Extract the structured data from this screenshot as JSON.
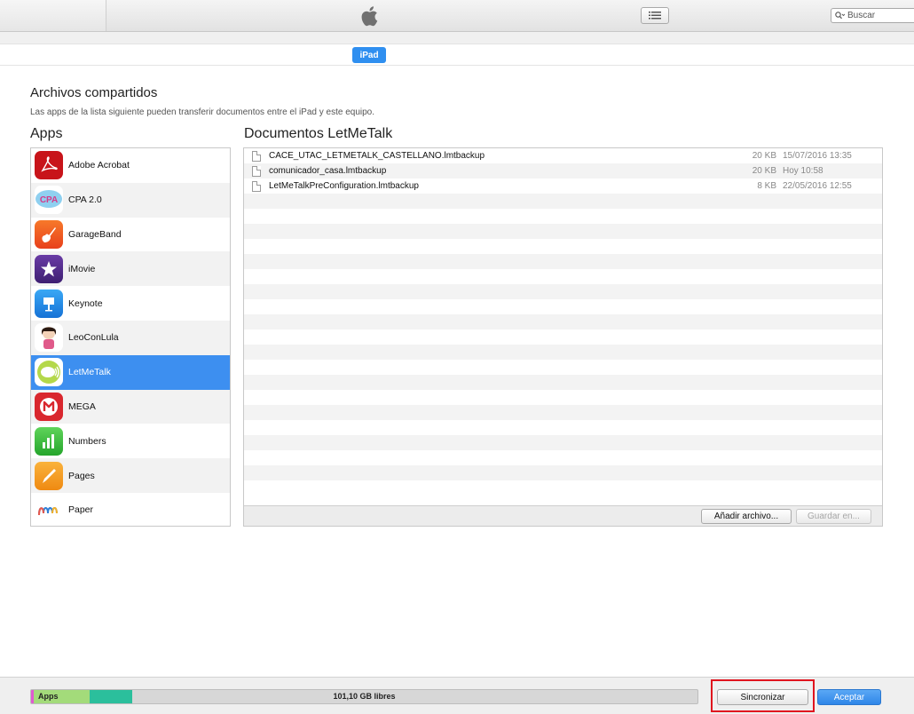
{
  "toolbar": {
    "search_placeholder": "Buscar"
  },
  "device": {
    "label": "iPad"
  },
  "section": {
    "title": "Archivos compartidos",
    "subtitle": "Las apps de la lista siguiente pueden transferir documentos entre el iPad y este equipo."
  },
  "apps": {
    "title": "Apps",
    "items": [
      {
        "label": "Adobe Acrobat",
        "icon": "adobe-acrobat-icon",
        "color": "#c8141a"
      },
      {
        "label": "CPA 2.0",
        "icon": "cpa-icon",
        "color": "#7ec8ef"
      },
      {
        "label": "GarageBand",
        "icon": "garageband-icon",
        "color": "#f35a22"
      },
      {
        "label": "iMovie",
        "icon": "imovie-icon",
        "color": "#5a2d8c"
      },
      {
        "label": "Keynote",
        "icon": "keynote-icon",
        "color": "#1f8fe6"
      },
      {
        "label": "LeoConLula",
        "icon": "leoconlula-icon",
        "color": "#e05a8a"
      },
      {
        "label": "LetMeTalk",
        "icon": "letmetalk-icon",
        "color": "#9ccc3c"
      },
      {
        "label": "MEGA",
        "icon": "mega-icon",
        "color": "#d9272e"
      },
      {
        "label": "Numbers",
        "icon": "numbers-icon",
        "color": "#3cbf3c"
      },
      {
        "label": "Pages",
        "icon": "pages-icon",
        "color": "#f39a1c"
      },
      {
        "label": "Paper",
        "icon": "paper-icon",
        "color": "#e8574a"
      }
    ],
    "selected": "LetMeTalk"
  },
  "documents": {
    "title": "Documentos LetMeTalk",
    "files": [
      {
        "name": "CACE_UTAC_LETMETALK_CASTELLANO.lmtbackup",
        "size": "20 KB",
        "date": "15/07/2016 13:35"
      },
      {
        "name": "comunicador_casa.lmtbackup",
        "size": "20 KB",
        "date": "Hoy 10:58"
      },
      {
        "name": "LetMeTalkPreConfiguration.lmtbackup",
        "size": "8 KB",
        "date": "22/05/2016 12:55"
      }
    ],
    "add_button": "Añadir archivo...",
    "save_button": "Guardar en..."
  },
  "storage": {
    "apps_label": "Apps",
    "free_label": "101,10 GB libres",
    "colors": {
      "other": "#e05ad0",
      "apps": "#a3db7a",
      "media": "#2bbf9c",
      "free": "#d7d7d7"
    }
  },
  "footer": {
    "sync_button": "Sincronizar",
    "accept_button": "Aceptar"
  }
}
